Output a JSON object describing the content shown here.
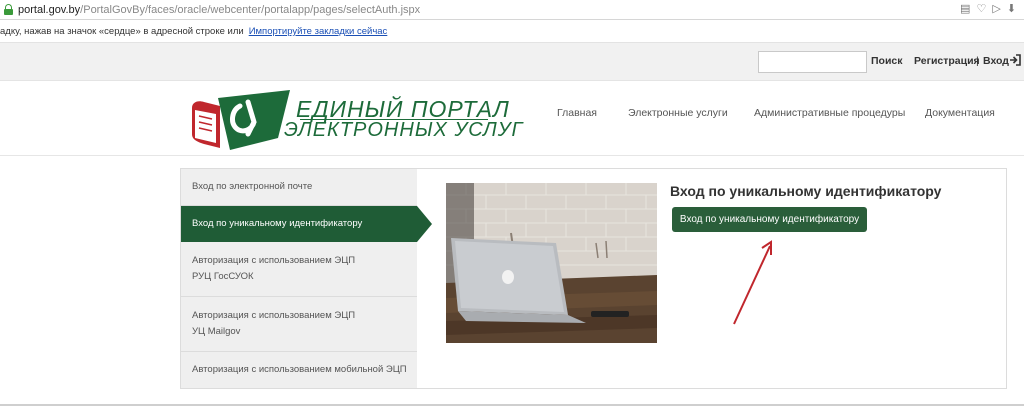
{
  "browser": {
    "url_host": "portal.gov.by",
    "url_path": "/PortalGovBy/faces/oracle/webcenter/portalapp/pages/selectAuth.jspx",
    "bookmark_prompt": "адку, нажав на значок «сердце» в адресной строке или",
    "bookmark_link": "Импортируйте закладки сейчас"
  },
  "topbar": {
    "search_button": "Поиск",
    "register_link": "Регистрация",
    "separator": "|",
    "login_link": "Вход"
  },
  "logo": {
    "line1": "ЕДИНЫЙ ПОРТАЛ",
    "line2": "ЭЛЕКТРОННЫХ УСЛУГ"
  },
  "nav": [
    "Главная",
    "Электронные услуги",
    "Административные процедуры",
    "Документация"
  ],
  "auth_menu": [
    {
      "line1": "Вход по электронной почте",
      "line2": ""
    },
    {
      "line1": "Вход по уникальному идентификатору",
      "line2": ""
    },
    {
      "line1": "Авторизация с использованием ЭЦП",
      "line2": "РУЦ ГосСУОК"
    },
    {
      "line1": "Авторизация с использованием ЭЦП",
      "line2": "УЦ Mailgov"
    },
    {
      "line1": "Авторизация с использованием мобильной ЭЦП",
      "line2": ""
    }
  ],
  "active_index": 1,
  "content": {
    "heading": "Вход по уникальному идентификатору",
    "button": "Вход по уникальному идентификатору"
  },
  "colors": {
    "brand_green": "#1d6b3a",
    "active_green": "#1f5c36",
    "annotation_red": "#c0272d"
  }
}
